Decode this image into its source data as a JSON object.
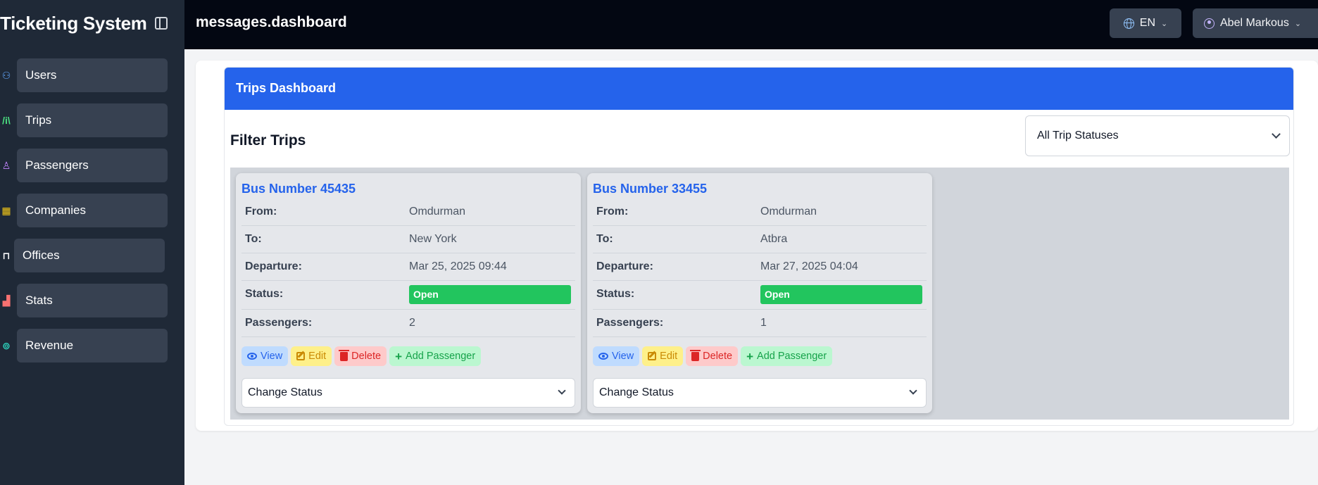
{
  "sidebar": {
    "brand": "Ticketing System",
    "items": [
      {
        "label": "Users",
        "icon": "users-icon",
        "color": "#60a5fa"
      },
      {
        "label": "Trips",
        "icon": "road-icon",
        "color": "#4ade80"
      },
      {
        "label": "Passengers",
        "icon": "user-icon",
        "color": "#c084fc"
      },
      {
        "label": "Companies",
        "icon": "building-icon",
        "color": "#facc15"
      },
      {
        "label": "Offices",
        "icon": "store-icon",
        "color": "#f3f4f6"
      },
      {
        "label": "Stats",
        "icon": "bar-chart-icon",
        "color": "#f87171"
      },
      {
        "label": "Revenue",
        "icon": "money-icon",
        "color": "#2dd4bf"
      }
    ]
  },
  "topbar": {
    "title": "messages.dashboard",
    "language": "EN",
    "user": "Abel Markous"
  },
  "dashboard": {
    "title": "Trips Dashboard",
    "filter_title": "Filter Trips",
    "status_filter": "All Trip Statuses"
  },
  "labels": {
    "from": "From:",
    "to": "To:",
    "departure": "Departure:",
    "status": "Status:",
    "passengers": "Passengers:",
    "view": "View",
    "edit": "Edit",
    "delete": "Delete",
    "add_passenger": "Add Passenger",
    "change_status": "Change Status"
  },
  "trips": [
    {
      "title": "Bus Number 45435",
      "from": "Omdurman",
      "to": "New York",
      "departure": "Mar 25, 2025 09:44",
      "status": "Open",
      "passengers": "2"
    },
    {
      "title": "Bus Number 33455",
      "from": "Omdurman",
      "to": "Atbra",
      "departure": "Mar 27, 2025 04:04",
      "status": "Open",
      "passengers": "1"
    }
  ]
}
